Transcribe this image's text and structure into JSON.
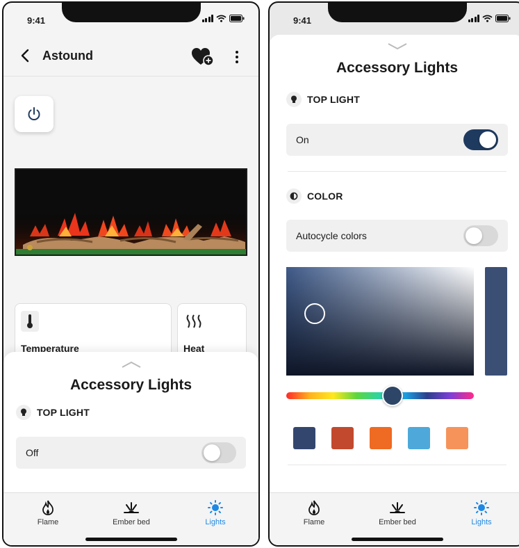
{
  "status_bar": {
    "time": "9:41"
  },
  "left_screen": {
    "header": {
      "title": "Astound"
    },
    "tiles": [
      {
        "label": "Temperature",
        "icon": "thermometer-icon"
      },
      {
        "label": "Heat",
        "icon": "heat-waves-icon"
      }
    ],
    "sheet": {
      "title": "Accessory Lights",
      "section": "TOP LIGHT",
      "row_label": "Off",
      "toggle_on": false
    }
  },
  "right_screen": {
    "title": "Accessory Lights",
    "top_light": {
      "section": "TOP LIGHT",
      "row_label": "On",
      "toggle_on": true
    },
    "color": {
      "section": "COLOR",
      "autocycle_label": "Autocycle colors",
      "autocycle_on": false,
      "selected_color": "#3b4f75",
      "swatches": [
        "#33466e",
        "#c2492d",
        "#ef6a22",
        "#4ea9da",
        "#f6935b"
      ]
    }
  },
  "tabbar": {
    "tabs": [
      {
        "label": "Flame",
        "icon": "flame-icon"
      },
      {
        "label": "Ember bed",
        "icon": "ember-bed-icon"
      },
      {
        "label": "Lights",
        "icon": "lights-icon",
        "active": true
      }
    ],
    "active_color": "#1e88e5"
  }
}
